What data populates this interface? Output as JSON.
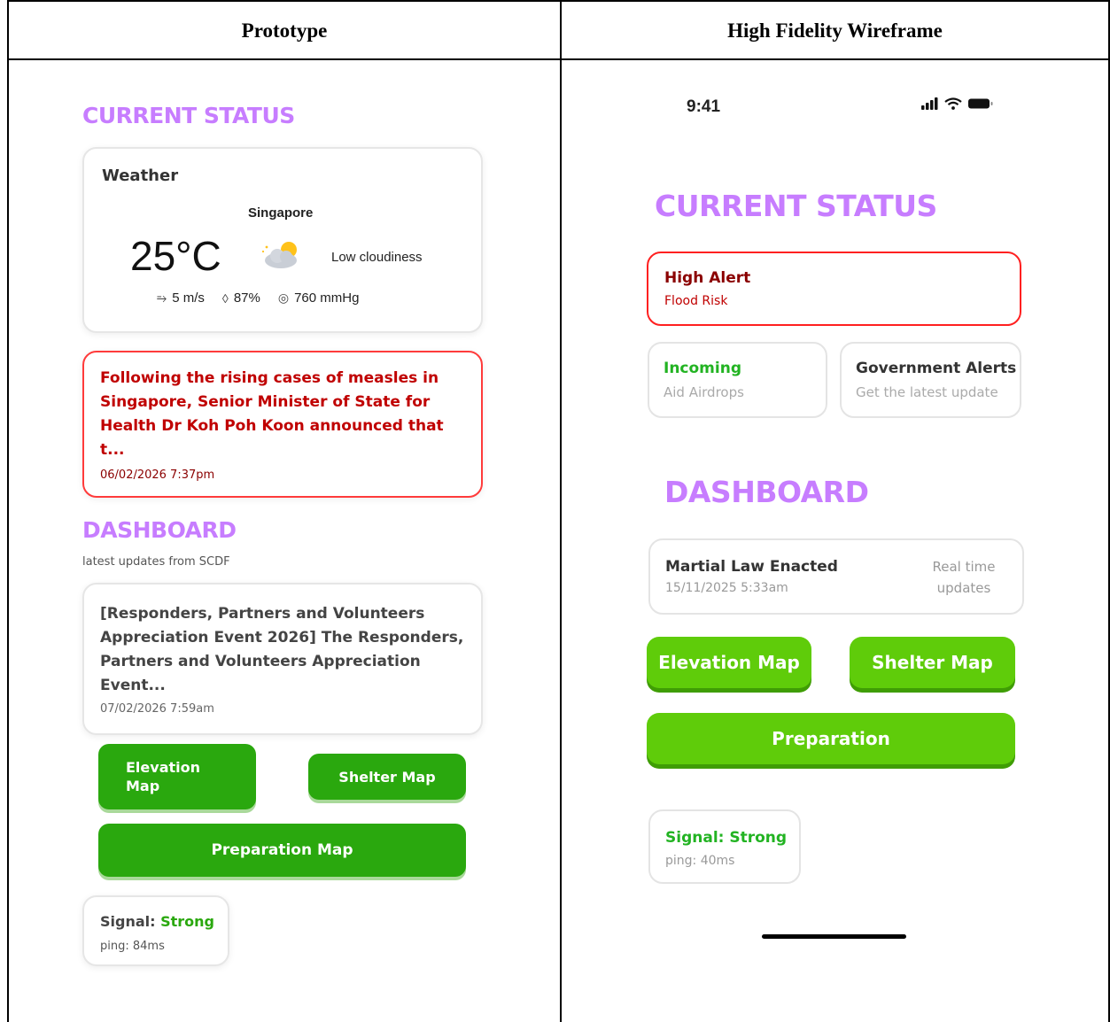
{
  "table": {
    "left_header": "Prototype",
    "right_header": "High Fidelity Wireframe"
  },
  "prototype": {
    "current_status_title": "CURRENT STATUS",
    "weather": {
      "label": "Weather",
      "city": "Singapore",
      "temperature": "25°C",
      "condition": "Low cloudiness",
      "icon": "partly-cloudy-icon",
      "wind": "5 m/s",
      "humidity": "87%",
      "pressure": "760 mmHg"
    },
    "news": {
      "text": "Following the rising cases of measles in Singapore, Senior Minister of State for Health Dr Koh Poh Koon announced that t...",
      "date": "06/02/2026    7:37pm"
    },
    "dashboard_title": "DASHBOARD",
    "dashboard_subtitle": "latest updates from SCDF",
    "update": {
      "text": "[Responders, Partners and Volunteers Appreciation Event 2026] The Responders, Partners and Volunteers Appreciation Event...",
      "date": "07/02/2026    7:59am"
    },
    "buttons": {
      "elevation_line1": "Elevation",
      "elevation_line2": "Map",
      "shelter": "Shelter Map",
      "preparation": "Preparation Map"
    },
    "signal": {
      "label": "Signal: ",
      "value": "Strong",
      "ping": "ping: 84ms"
    }
  },
  "wireframe": {
    "status_bar": {
      "time": "9:41",
      "icons": [
        "signal-bars-icon",
        "wifi-icon",
        "battery-icon"
      ]
    },
    "current_status_title": "CURRENT STATUS",
    "alert": {
      "title": "High Alert",
      "subtitle": "Flood Risk"
    },
    "incoming": {
      "title": "Incoming",
      "subtitle": "Aid Airdrops"
    },
    "government": {
      "title": "Government Alerts",
      "subtitle": "Get the latest update"
    },
    "dashboard_title": "DASHBOARD",
    "martial": {
      "title": "Martial Law Enacted",
      "date": "15/11/2025  5:33am",
      "realtime": "Real time updates"
    },
    "buttons": {
      "elevation": "Elevation Map",
      "shelter": "Shelter Map",
      "preparation": "Preparation"
    },
    "signal": {
      "title": "Signal: Strong",
      "ping": "ping: 40ms"
    }
  },
  "colors": {
    "section_title": "#c77dff",
    "alert_red": "#ff2020",
    "proto_green": "#2aa80e",
    "wire_green": "#5fcc0a"
  }
}
